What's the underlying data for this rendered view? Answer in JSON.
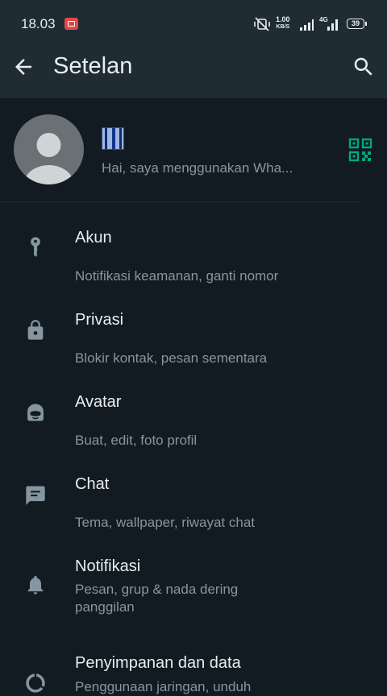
{
  "status_bar": {
    "time": "18.03",
    "net_speed_value": "1.00",
    "net_speed_unit": "KB/S",
    "network_type": "4G",
    "battery": "39"
  },
  "app_bar": {
    "title": "Setelan",
    "back_icon": "arrow-back-icon",
    "search_icon": "search-icon"
  },
  "profile": {
    "about": "Hai, saya menggunakan Wha...",
    "qr_icon": "qr-code-icon"
  },
  "settings": [
    {
      "id": "akun",
      "title": "Akun",
      "subtitle": "Notifikasi keamanan, ganti nomor",
      "icon": "key-icon"
    },
    {
      "id": "privasi",
      "title": "Privasi",
      "subtitle": "Blokir kontak, pesan sementara",
      "icon": "lock-icon"
    },
    {
      "id": "avatar",
      "title": "Avatar",
      "subtitle": "Buat, edit, foto profil",
      "icon": "avatar-face-icon"
    },
    {
      "id": "chat",
      "title": "Chat",
      "subtitle": "Tema, wallpaper, riwayat chat",
      "icon": "chat-icon"
    },
    {
      "id": "notifikasi",
      "title": "Notifikasi",
      "subtitle": "Pesan, grup & nada dering panggilan",
      "icon": "bell-icon"
    },
    {
      "id": "penyimpanan",
      "title": "Penyimpanan dan data",
      "subtitle": "Penggunaan jaringan, unduh",
      "icon": "data-usage-icon"
    }
  ],
  "colors": {
    "background": "#111b21",
    "header": "#1f2c34",
    "accent": "#00a884",
    "icon": "#8696a0",
    "secondary_text": "#8696a0"
  }
}
